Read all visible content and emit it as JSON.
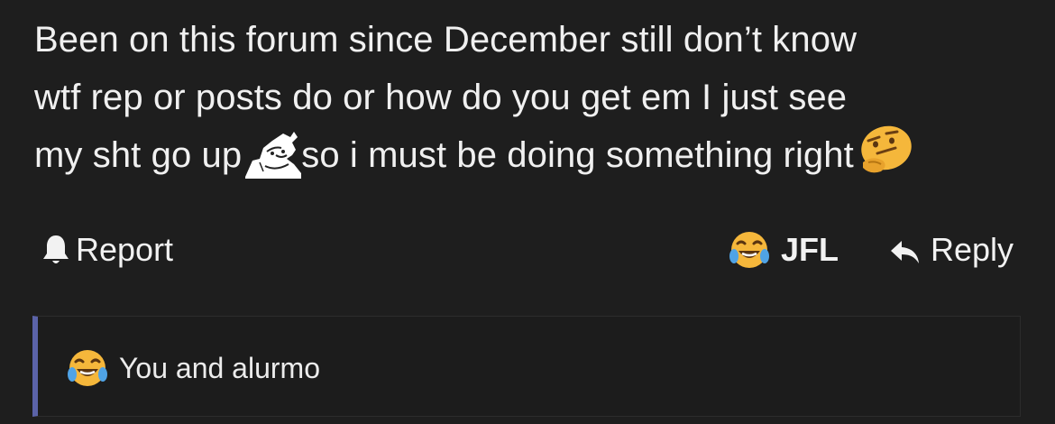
{
  "post": {
    "line1": "Been on this forum since December still don’t know",
    "line2": "wtf rep or posts do or how do you get em I just see",
    "line3_before": "my sht go up",
    "line3_after": "so i must be doing something right",
    "inline_emojis": [
      "meme-face-icon",
      "thinking-face-icon"
    ]
  },
  "actions": {
    "report_label": "Report",
    "report_icon": "bell-icon",
    "reaction_label": "JFL",
    "reaction_icon": "laughing-crying-emoji-icon",
    "reply_label": "Reply",
    "reply_icon": "reply-arrow-icon"
  },
  "quote": {
    "text": "You and alurmo",
    "icon": "laughing-crying-emoji-icon",
    "accent_color": "#5b63a8"
  },
  "colors": {
    "background": "#1e1e1e",
    "text": "#f0f0f0",
    "emoji_yellow": "#f5b73b"
  }
}
